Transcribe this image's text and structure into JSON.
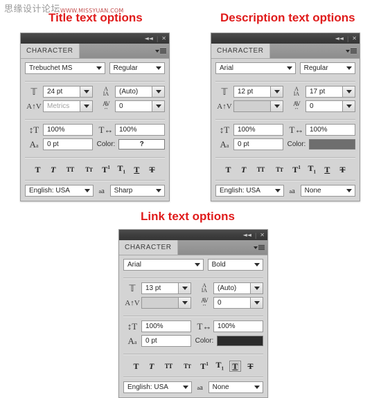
{
  "watermark": {
    "text": "思缘设计论坛",
    "url": "WWW.MISSYUAN.COM"
  },
  "headings": {
    "title_panel": "Title text options",
    "description_panel": "Description text options",
    "link_panel": "Link text options"
  },
  "colors": {
    "heading_red": "#e01b1b",
    "panel_bg": "#d4d4d4",
    "titlebar": "#3e3e3e",
    "title_swatch": "",
    "description_swatch": "#6e6e6e",
    "link_swatch": "#2b2b2b"
  },
  "panel_chrome": {
    "tab_label": "CHARACTER",
    "collapse_icon": "◀◀",
    "close_icon": "✕",
    "menu_icon": "panel-menu-icon"
  },
  "icon_labels": {
    "font_size": "font-size-icon",
    "leading": "leading-icon",
    "kerning": "kerning-icon",
    "tracking": "tracking-icon",
    "vertical_scale": "vertical-scale-icon",
    "horizontal_scale": "horizontal-scale-icon",
    "baseline_shift": "baseline-shift-icon",
    "color": "Color:",
    "anti_alias": "anti-alias-icon"
  },
  "style_buttons": [
    {
      "name": "faux-bold",
      "glyph": "T",
      "style": "bold"
    },
    {
      "name": "faux-italic",
      "glyph": "T",
      "style": "italic"
    },
    {
      "name": "all-caps",
      "glyph": "TT",
      "style": "caps"
    },
    {
      "name": "small-caps",
      "glyph": "Tr",
      "style": "smallcaps"
    },
    {
      "name": "superscript",
      "glyph": "T1",
      "style": "sup"
    },
    {
      "name": "subscript",
      "glyph": "T1",
      "style": "sub"
    },
    {
      "name": "underline",
      "glyph": "T",
      "style": "underline"
    },
    {
      "name": "strikethrough",
      "glyph": "T",
      "style": "strike"
    }
  ],
  "panels": {
    "title": {
      "heading": "Title text options",
      "font_family": "Trebuchet MS",
      "font_style": "Regular",
      "font_size": "24 pt",
      "leading": "(Auto)",
      "kerning": "Metrics",
      "kerning_dim": true,
      "tracking": "0",
      "vertical_scale": "100%",
      "horizontal_scale": "100%",
      "baseline_shift": "0 pt",
      "color_label": "Color:",
      "color_value": "?",
      "color_hex": "#ffffff",
      "language": "English: USA",
      "anti_alias": "Sharp",
      "active_style": null
    },
    "description": {
      "heading": "Description text options",
      "font_family": "Arial",
      "font_style": "Regular",
      "font_size": "12 pt",
      "leading": "17 pt",
      "kerning": "",
      "kerning_dim": true,
      "tracking": "0",
      "vertical_scale": "100%",
      "horizontal_scale": "100%",
      "baseline_shift": "0 pt",
      "color_label": "Color:",
      "color_value": "",
      "color_hex": "#6e6e6e",
      "language": "English: USA",
      "anti_alias": "None",
      "active_style": null
    },
    "link": {
      "heading": "Link text options",
      "font_family": "Arial",
      "font_style": "Bold",
      "font_size": "13 pt",
      "leading": "(Auto)",
      "kerning": "",
      "kerning_dim": true,
      "tracking": "0",
      "vertical_scale": "100%",
      "horizontal_scale": "100%",
      "baseline_shift": "0 pt",
      "color_label": "Color:",
      "color_value": "",
      "color_hex": "#2b2b2b",
      "language": "English: USA",
      "anti_alias": "None",
      "active_style": "underline"
    }
  }
}
